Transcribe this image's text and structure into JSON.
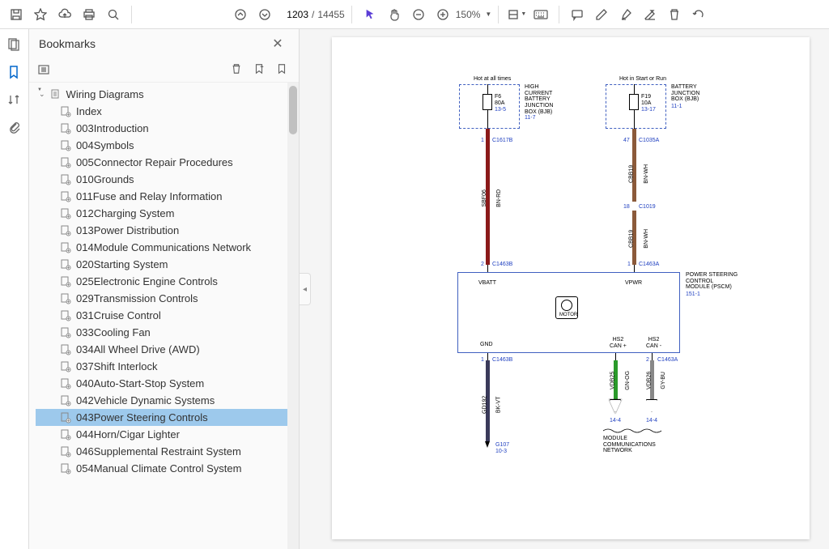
{
  "toolbar": {
    "page_current": "1203",
    "page_total": "14455",
    "zoom": "150%"
  },
  "panel": {
    "title": "Bookmarks"
  },
  "tree": {
    "root": "Wiring Diagrams",
    "items": [
      "Index",
      "003Introduction",
      "004Symbols",
      "005Connector Repair Procedures",
      "010Grounds",
      "011Fuse and Relay Information",
      "012Charging System",
      "013Power Distribution",
      "014Module Communications Network",
      "020Starting System",
      "025Electronic Engine Controls",
      "029Transmission Controls",
      "031Cruise Control",
      "033Cooling Fan",
      "034All Wheel Drive (AWD)",
      "037Shift Interlock",
      "040Auto-Start-Stop System",
      "042Vehicle Dynamic Systems",
      "043Power Steering Controls",
      "044Horn/Cigar Lighter",
      "046Supplemental Restraint System",
      "054Manual Climate Control System"
    ],
    "selected_index": 18
  },
  "diagram": {
    "headers": {
      "hot_always": "Hot at all times",
      "hot_start": "Hot in Start or Run"
    },
    "box_left": {
      "fuse": "F6",
      "amp": "80A",
      "ref": "13-5",
      "name": "HIGH\nCURRENT\nBATTERY\nJUNCTION\nBOX (BJB)",
      "nref": "11-7"
    },
    "box_right": {
      "fuse": "F19",
      "amp": "10A",
      "ref": "13-17",
      "name": "BATTERY\nJUNCTION\nBOX (BJB)",
      "nref": "11-1"
    },
    "conn": {
      "l_pin1": "1",
      "l_c1": "C1617B",
      "r_pin1": "47",
      "r_c1": "C1035A",
      "mid_pin": "18",
      "mid_c": "C1019",
      "l_pin2": "2",
      "l_c2": "C1463B",
      "r_pin2": "1",
      "r_c2": "C1463A",
      "l_pin3": "1",
      "l_c3": "C1463B",
      "r_pin3": "2",
      "r_c3": "C1463A"
    },
    "wires": {
      "l_id": "SBF06",
      "l_col": "BN-RD",
      "r_id1": "CBB19",
      "r_col1": "BN-WH",
      "r_id2": "CBB19",
      "r_col2": "BN-WH",
      "g_id": "GD192",
      "g_col": "BK-VT",
      "can1_id": "VDB25",
      "can1_col": "GN-OG",
      "can2_id": "VDB26",
      "can2_col": "GY-BU"
    },
    "module": {
      "name": "POWER STEERING\nCONTROL\nMODULE (PSCM)",
      "ref": "151-1",
      "vbatt": "VBATT",
      "vpwr": "VPWR",
      "gnd": "GND",
      "can_p": "HS2\nCAN +",
      "can_n": "HS2\nCAN -",
      "motor": "MOTOR"
    },
    "ground": {
      "name": "G107",
      "ref": "10-3"
    },
    "network": {
      "ref1": "14-4",
      "ref2": "14-4",
      "name": "MODULE\nCOMMUNICATIONS\nNETWORK"
    }
  }
}
